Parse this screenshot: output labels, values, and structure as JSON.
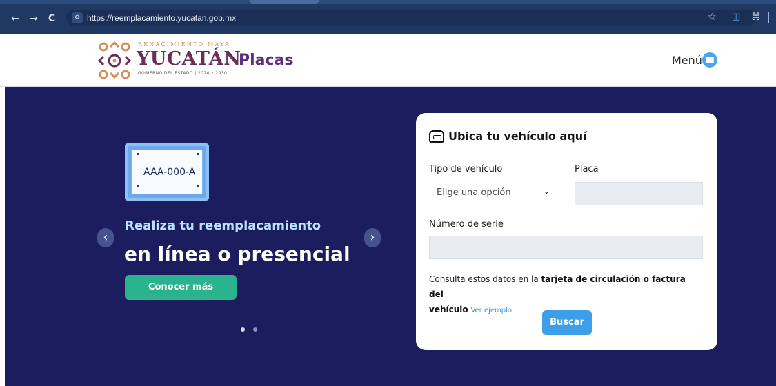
{
  "browser": {
    "url": "https://reemplacamiento.yucatan.gob.mx",
    "nav": {
      "back": "←",
      "forward": "→",
      "reload": "C"
    },
    "icons": {
      "site": "site-settings-icon",
      "bookmark": "star-icon",
      "extension": "extension-icon",
      "puzzle": "puzzle-icon"
    }
  },
  "header": {
    "logo_top": "RENACIMIENTO MAYA",
    "logo_main": "YUCATÁN",
    "logo_sub": "GOBIERNO DEL ESTADO | 2024 • 2030",
    "section": "Placas",
    "menu_label": "Menú",
    "accent": "#5b2e7e",
    "menu_icon": "menu-icon"
  },
  "hero": {
    "plate_text": "AAA-000-A",
    "subtitle": "Realiza tu reemplacamiento",
    "title": "en línea o presencial",
    "cta_label": "Conocer más",
    "arrow_left": "‹",
    "arrow_right": "›",
    "colors": {
      "background": "#1c1d5f",
      "cta": "#2bb38f",
      "subtitle": "#b9e2ff"
    }
  },
  "search": {
    "title": "Ubica tu vehículo aquí",
    "vehicle_type_label": "Tipo de vehículo",
    "vehicle_type_value": "Elige una opción",
    "plate_label": "Placa",
    "serial_label": "Número de serie",
    "help_text_start": "Consulta estos datos en la ",
    "help_text_strong": "tarjeta de circulación o factura del",
    "help_text_strong_2": "vehículo",
    "help_link": "Ver ejemplo",
    "button_label": "Buscar",
    "icons": {
      "vehicle": "car-icon",
      "dropdown": "chevron-down-icon"
    }
  }
}
